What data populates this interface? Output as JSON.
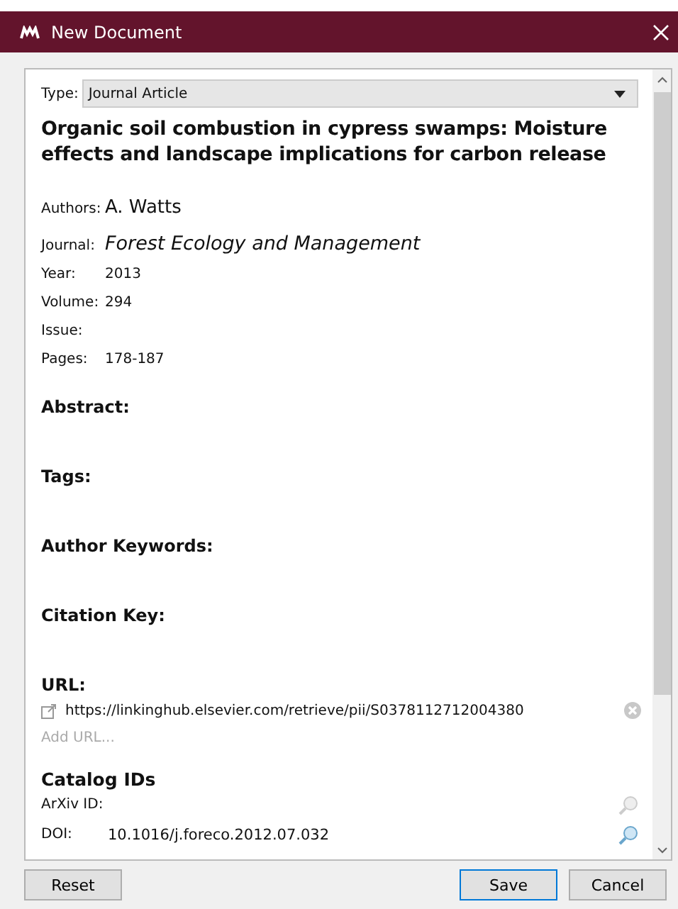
{
  "window": {
    "title": "New Document"
  },
  "type_field": {
    "label": "Type:",
    "value": "Journal Article"
  },
  "title": "Organic soil combustion in cypress swamps: Moisture effects and landscape implications for carbon release",
  "fields": [
    {
      "label": "Authors:",
      "value": "A. Watts",
      "kind": "large"
    },
    {
      "label": "Journal:",
      "value": "Forest Ecology and Management",
      "kind": "italic"
    },
    {
      "label": "Year:",
      "value": "2013",
      "kind": "plain"
    },
    {
      "label": "Volume:",
      "value": "294",
      "kind": "plain"
    },
    {
      "label": "Issue:",
      "kind": "plain"
    },
    {
      "label": "Pages:",
      "value": "178-187",
      "kind": "plain"
    }
  ],
  "sections": [
    "Abstract:",
    "Tags:",
    "Author Keywords:",
    "Citation Key:"
  ],
  "url": {
    "heading": "URL:",
    "link": "https://linkinghub.elsevier.com/retrieve/pii/S0378112712004380",
    "add_placeholder": "Add URL..."
  },
  "catalog": {
    "heading": "Catalog IDs",
    "items": [
      {
        "label": "ArXiv ID:",
        "lookup_enabled": false
      },
      {
        "label": "DOI:",
        "value": "10.1016/j.foreco.2012.07.032",
        "lookup_enabled": true
      }
    ]
  },
  "buttons": {
    "reset": "Reset",
    "save": "Save",
    "cancel": "Cancel"
  }
}
